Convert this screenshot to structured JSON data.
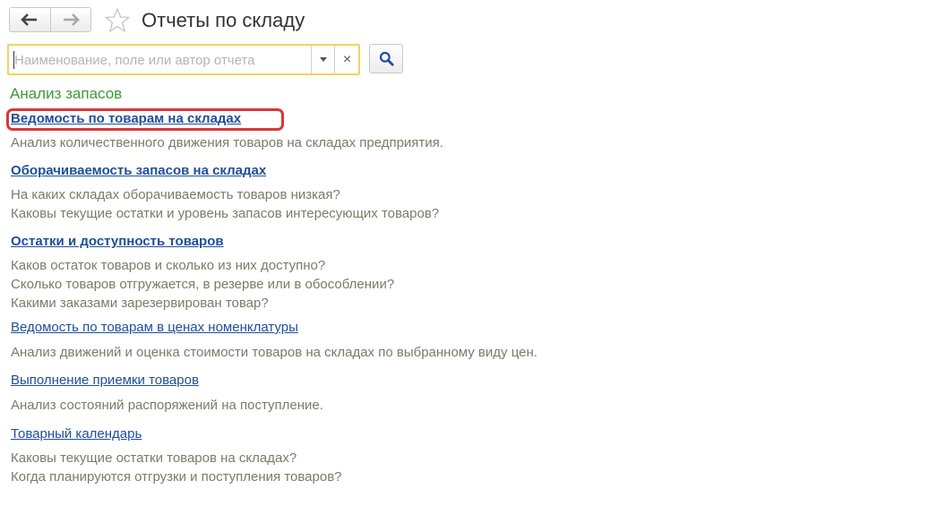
{
  "header": {
    "title": "Отчеты по складу",
    "back_icon": "arrow-left-icon",
    "forward_icon": "arrow-right-icon",
    "favorite_icon": "star-icon"
  },
  "search": {
    "placeholder": "Наименование, поле или автор отчета",
    "value": "",
    "clear_label": "×",
    "button_icon": "search-icon"
  },
  "section": {
    "title": "Анализ запасов"
  },
  "reports": [
    {
      "title": "Ведомость по товарам на складах",
      "highlighted": true,
      "description": [
        "Анализ количественного движения товаров на складах предприятия."
      ]
    },
    {
      "title": "Оборачиваемость запасов на складах",
      "description": [
        "На каких складах оборачиваемость товаров низкая?",
        "Каковы текущие остатки и уровень запасов интересующих товаров?"
      ]
    },
    {
      "title": "Остатки и доступность товаров",
      "description": [
        "Каков остаток товаров и сколько из них доступно?",
        "Сколько товаров отгружается, в резерве или в обособлении?",
        "Какими заказами зарезервирован товар?"
      ]
    },
    {
      "title": "Ведомость по товарам в ценах номенклатуры",
      "description": [
        "Анализ движений и оценка стоимости товаров на складах по выбранному виду цен."
      ]
    },
    {
      "title": "Выполнение приемки товаров",
      "description": [
        "Анализ состояний распоряжений на поступление."
      ]
    },
    {
      "title": "Товарный календарь",
      "description": [
        "Каковы текущие остатки товаров на складах?",
        "Когда планируются отгрузки и поступления товаров?"
      ]
    }
  ],
  "colors": {
    "link": "#1f4e9c",
    "section_title": "#3c9a3c",
    "description": "#7b7b6a",
    "highlight": "#d8383a",
    "search_focus": "#f2d35c"
  }
}
